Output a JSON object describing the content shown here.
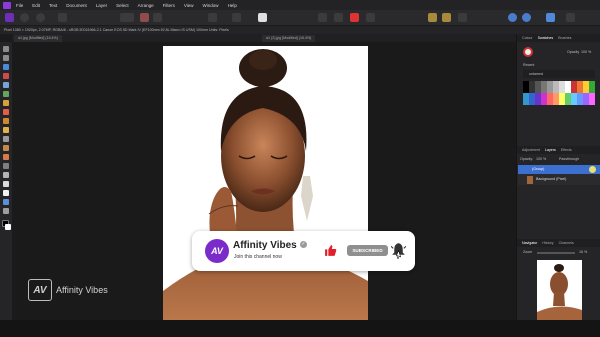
{
  "menubar": {
    "items": [
      "File",
      "Edit",
      "Text",
      "Document",
      "Layer",
      "Select",
      "Arrange",
      "Filters",
      "View",
      "Window",
      "Help"
    ]
  },
  "context_bar": {
    "text": "Pixel  1080 × 1920px, 2.07MP, RGBA/8 - sRGB IEC61966-2.1  Canon EOS 5D Mark IV (EF100mm f/2.8L Macro IS USM) 100mm  Units: Pixels"
  },
  "tabs": {
    "doc_tab": "a1.jpg [Modified] (16.4%)",
    "doc_tab_2": "a1 (2).jpg [Modified] (16.4%)"
  },
  "right_panel": {
    "top_tabs": [
      "Colour",
      "Swatches",
      "Brushes"
    ],
    "opacity_label": "Opacity",
    "opacity_value": "100 %",
    "recent_label": "Recent",
    "palette_label": "untamed",
    "layer_tabs": [
      "Adjustment",
      "Layers",
      "Effects"
    ],
    "layer_opacity_label": "Opacity:",
    "layer_opacity_value": "100 %",
    "blend_mode": "Passthrough",
    "layers": [
      {
        "name": "(Group)",
        "selected": true
      },
      {
        "name": "Background (Pixel)",
        "selected": false
      }
    ],
    "nav_tabs": [
      "Navigator",
      "History",
      "Channels"
    ],
    "zoom_label": "Zoom",
    "zoom_value": "16 %"
  },
  "watermark": {
    "logo_text": "AV",
    "text": "Affinity Vibes"
  },
  "popup": {
    "logo_text": "AV",
    "channel_name": "Affinity Vibes",
    "subtitle": "Join this channel now",
    "subscribe_label": "SUBSCRIBED",
    "verified_icon": "✓"
  },
  "colors": {
    "accent": "#7a2bc9",
    "thumb": "#e0212b",
    "selected_layer": "#3b6fd0"
  }
}
